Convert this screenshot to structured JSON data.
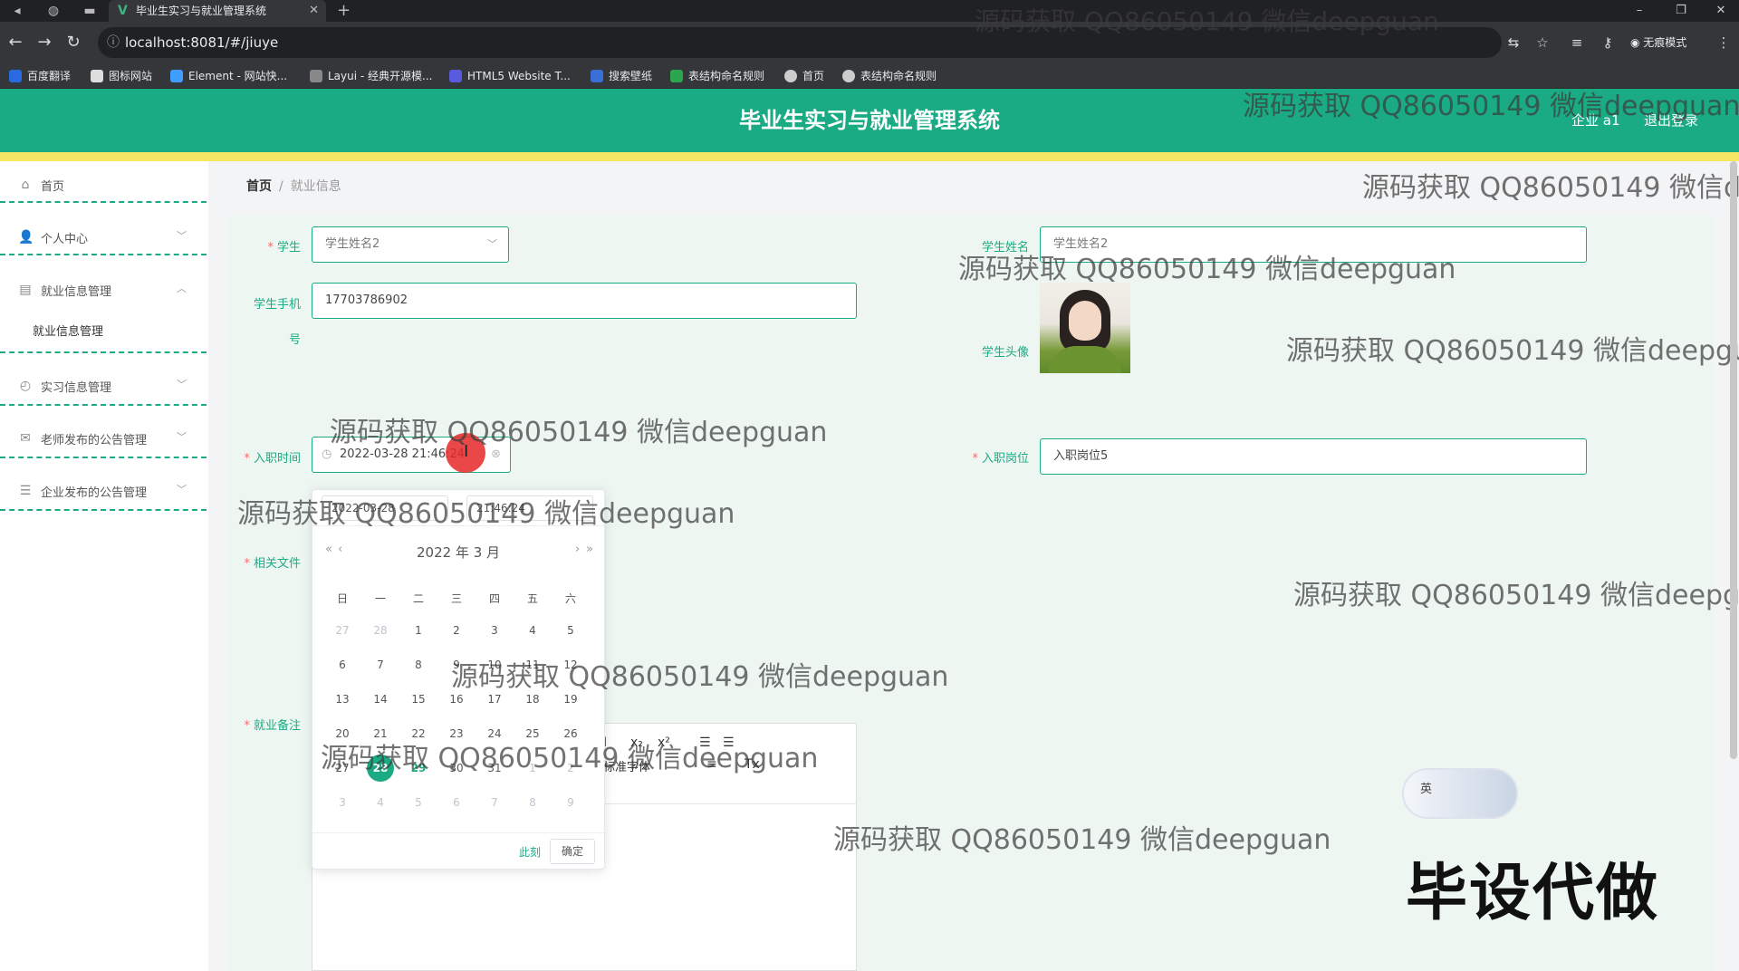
{
  "browser": {
    "tab_title": "毕业生实习与就业管理系统",
    "tab_favicon": "V",
    "url": "localhost:8081/#/jiuye",
    "incognito_label": "无痕模式",
    "bookmarks": [
      {
        "label": "百度翻译",
        "color": "#2a6ae0"
      },
      {
        "label": "图标网站",
        "color": "#dddddd"
      },
      {
        "label": "Element - 网站快...",
        "color": "#409eff"
      },
      {
        "label": "Layui - 经典开源模...",
        "color": "#888888"
      },
      {
        "label": "HTML5 Website T...",
        "color": "#5a5adf"
      },
      {
        "label": "搜索壁纸",
        "color": "#3a6fd8"
      },
      {
        "label": "表结构命名规则",
        "color": "#2da44e"
      },
      {
        "label": "首页",
        "color": "#cccccc"
      },
      {
        "label": "表结构命名规则",
        "color": "#cccccc"
      }
    ]
  },
  "header": {
    "title": "毕业生实习与就业管理系统",
    "user": "企业 a1",
    "logout": "退出登录",
    "color": "#1aab84",
    "stripe_color": "#f5e663"
  },
  "sidebar": {
    "items": [
      {
        "label": "首页",
        "icon": "home-icon"
      },
      {
        "label": "个人中心",
        "icon": "user-icon"
      },
      {
        "label": "就业信息管理",
        "icon": "clipboard-icon"
      },
      {
        "label": "实习信息管理",
        "icon": "clock-icon"
      },
      {
        "label": "老师发布的公告管理",
        "icon": "mail-icon"
      },
      {
        "label": "企业发布的公告管理",
        "icon": "sliders-icon"
      }
    ],
    "submenu_active": "就业信息管理"
  },
  "breadcrumb": {
    "home": "首页",
    "separator": "/",
    "current": "就业信息"
  },
  "form": {
    "student_label": "学生",
    "student_value": "学生姓名2",
    "student_name_label": "学生姓名",
    "student_name_value": "学生姓名2",
    "phone_label_1": "学生手机",
    "phone_label_2": "号",
    "phone_value": "17703786902",
    "avatar_label": "学生头像",
    "entry_time_label": "入职时间",
    "entry_time_value": "2022-03-28 21:46:24",
    "position_label": "入职岗位",
    "position_value": "入职岗位5",
    "files_label": "相关文件",
    "remarks_label": "就业备注"
  },
  "datepicker": {
    "date_input": "2022-03-28",
    "time_input": "21:46:24",
    "header": "2022 年  3 月",
    "prev_year": "«",
    "prev_month": "‹",
    "next_month": "›",
    "next_year": "»",
    "weekdays": [
      "日",
      "一",
      "二",
      "三",
      "四",
      "五",
      "六"
    ],
    "weeks": [
      [
        {
          "d": "27",
          "m": 1
        },
        {
          "d": "28",
          "m": 1
        },
        {
          "d": "1"
        },
        {
          "d": "2"
        },
        {
          "d": "3"
        },
        {
          "d": "4"
        },
        {
          "d": "5"
        }
      ],
      [
        {
          "d": "6"
        },
        {
          "d": "7"
        },
        {
          "d": "8"
        },
        {
          "d": "9"
        },
        {
          "d": "10"
        },
        {
          "d": "11"
        },
        {
          "d": "12"
        }
      ],
      [
        {
          "d": "13"
        },
        {
          "d": "14"
        },
        {
          "d": "15"
        },
        {
          "d": "16"
        },
        {
          "d": "17"
        },
        {
          "d": "18"
        },
        {
          "d": "19"
        }
      ],
      [
        {
          "d": "20"
        },
        {
          "d": "21"
        },
        {
          "d": "22"
        },
        {
          "d": "23"
        },
        {
          "d": "24"
        },
        {
          "d": "25"
        },
        {
          "d": "26"
        }
      ],
      [
        {
          "d": "27"
        },
        {
          "d": "28",
          "s": 1
        },
        {
          "d": "29",
          "t": 1
        },
        {
          "d": "30"
        },
        {
          "d": "31"
        },
        {
          "d": "1",
          "m": 1
        },
        {
          "d": "2",
          "m": 1
        }
      ],
      [
        {
          "d": "3",
          "m": 1
        },
        {
          "d": "4",
          "m": 1
        },
        {
          "d": "5",
          "m": 1
        },
        {
          "d": "6",
          "m": 1
        },
        {
          "d": "7",
          "m": 1
        },
        {
          "d": "8",
          "m": 1
        },
        {
          "d": "9",
          "m": 1
        }
      ]
    ],
    "now": "此刻",
    "ok": "确定"
  },
  "editor": {
    "toolbar": [
      "I",
      "x₂",
      "x²",
      "☰",
      "☰",
      "标准字体",
      "≡",
      "Tx"
    ]
  },
  "overlays": {
    "watermark": "源码获取 QQ86050149 微信deepguan",
    "badge": "毕设代做",
    "ime_label": "英"
  }
}
